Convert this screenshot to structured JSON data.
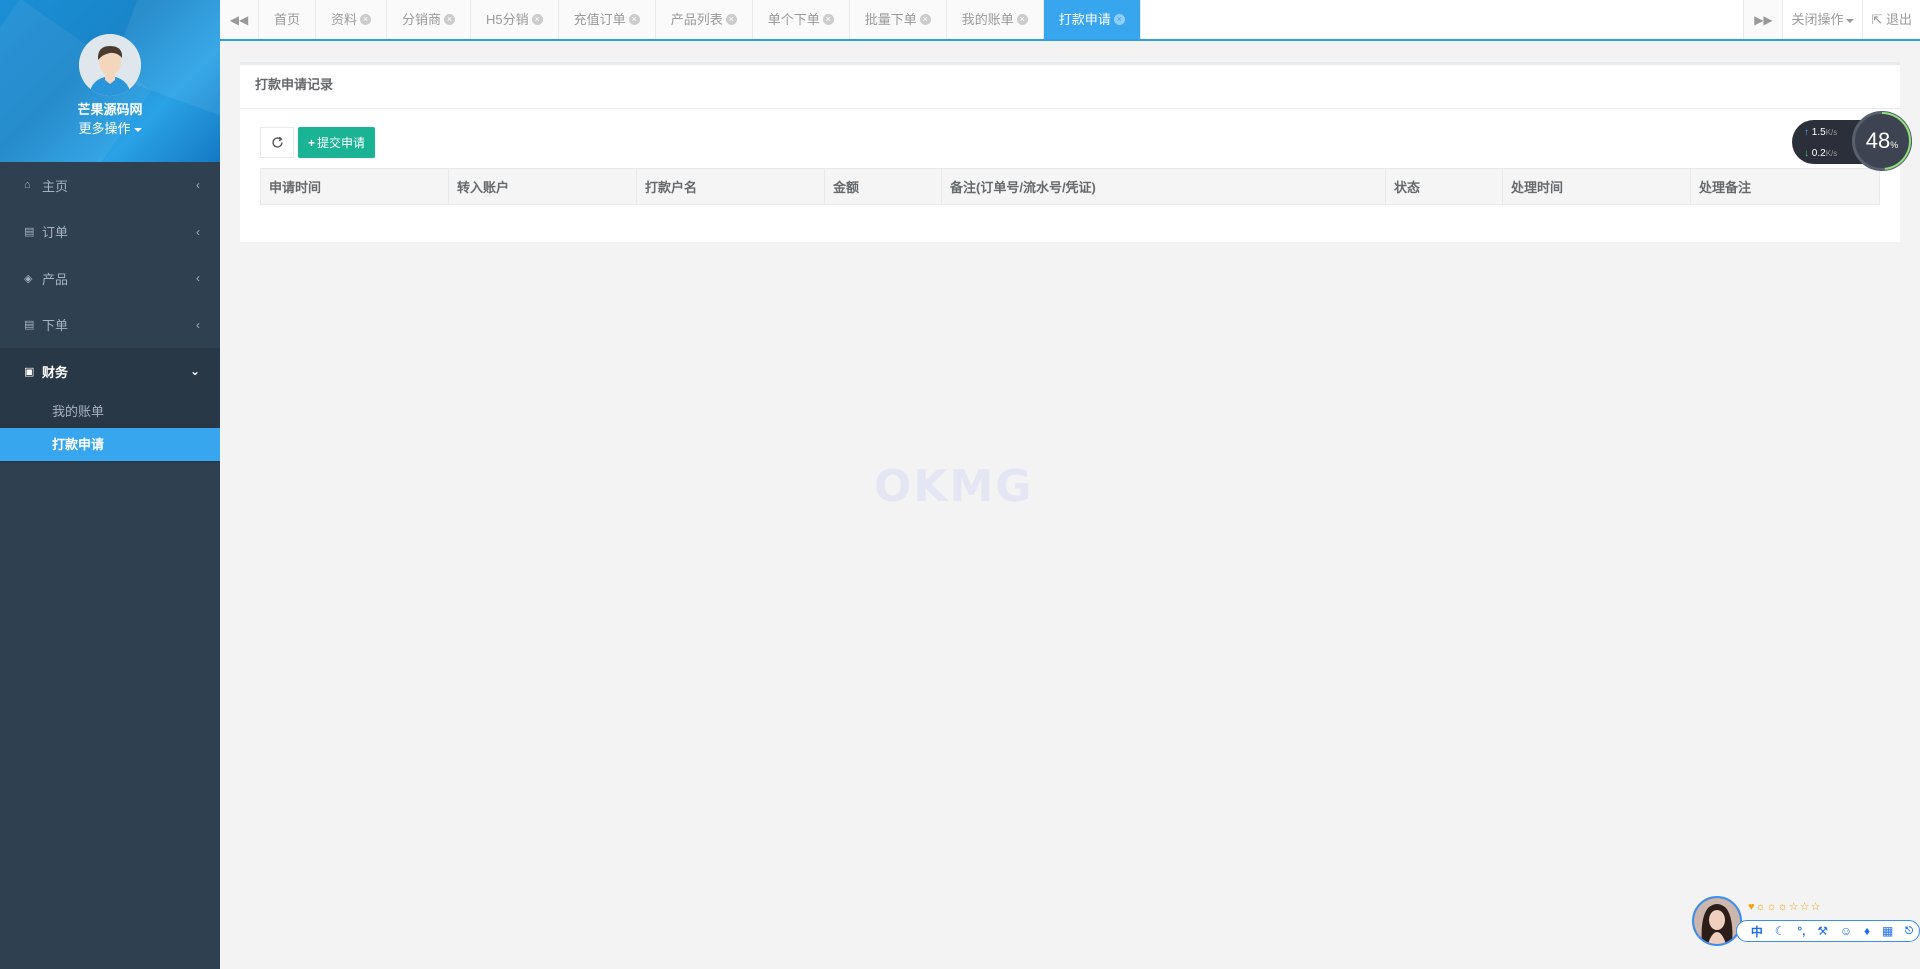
{
  "sidebar": {
    "profile": {
      "name": "芒果源码网",
      "more": "更多操作"
    },
    "items": [
      {
        "label": "主页",
        "icon": "home-icon"
      },
      {
        "label": "订单",
        "icon": "file-icon"
      },
      {
        "label": "产品",
        "icon": "cube-icon"
      },
      {
        "label": "下单",
        "icon": "file-icon"
      },
      {
        "label": "财务",
        "icon": "money-icon"
      }
    ],
    "finance_sub": [
      {
        "label": "我的账单"
      },
      {
        "label": "打款申请"
      }
    ]
  },
  "tabs": [
    {
      "label": "首页"
    },
    {
      "label": "资料"
    },
    {
      "label": "分销商"
    },
    {
      "label": "H5分销"
    },
    {
      "label": "充值订单"
    },
    {
      "label": "产品列表"
    },
    {
      "label": "单个下单"
    },
    {
      "label": "批量下单"
    },
    {
      "label": "我的账单"
    },
    {
      "label": "打款申请"
    }
  ],
  "tools": {
    "close_ops": "关闭操作",
    "logout": "退出"
  },
  "panel": {
    "title": "打款申请记录",
    "add_button": "提交申请",
    "columns": [
      "申请时间",
      "转入账户",
      "打款户名",
      "金额",
      "备注(订单号/流水号/凭证)",
      "状态",
      "处理时间",
      "处理备注"
    ]
  },
  "watermark": "OKMG",
  "speed": {
    "up": "1.5",
    "down": "0.2",
    "unit": "K/s",
    "percent": "48",
    "percent_sign": "%"
  },
  "ime": {
    "mode": "中"
  },
  "colors": {
    "sidebar": "#2f4050",
    "accent": "#38a5ef",
    "success": "#1ab394"
  }
}
